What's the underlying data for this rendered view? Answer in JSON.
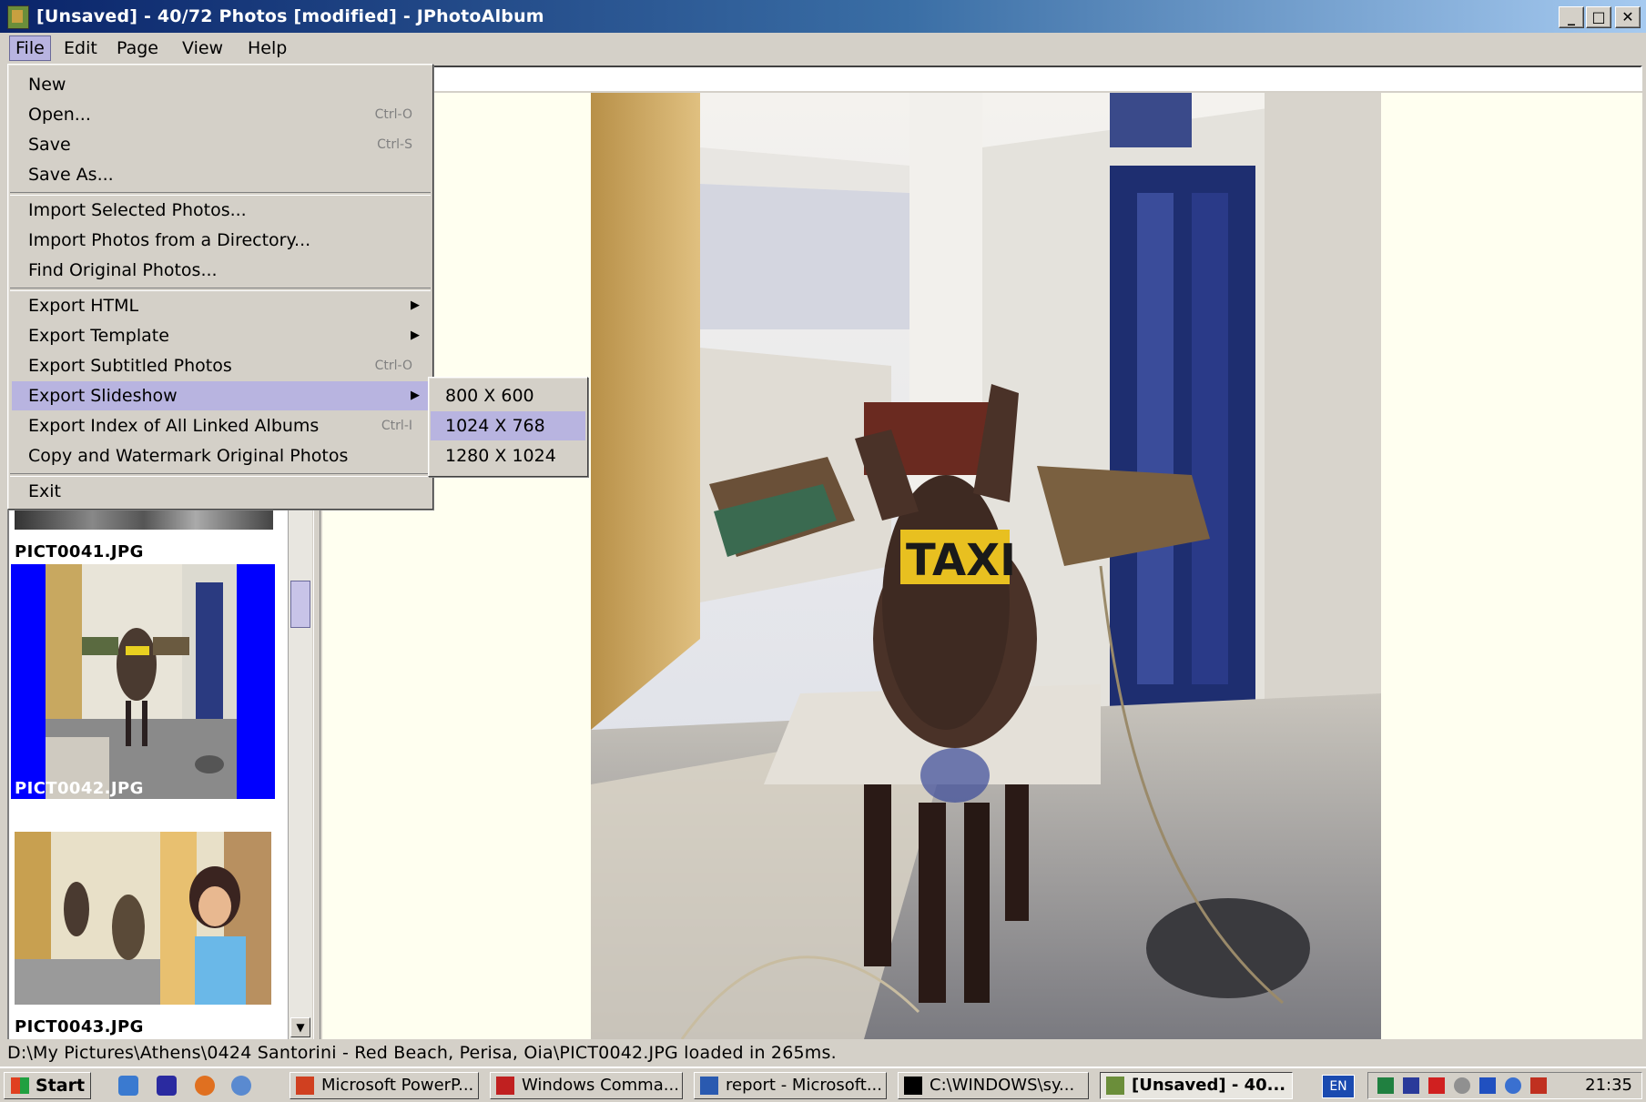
{
  "window": {
    "title": "[Unsaved] - 40/72 Photos  [modified] - JPhotoAlbum",
    "minimize": "_",
    "maximize": "□",
    "close": "✕"
  },
  "menubar": {
    "items": [
      {
        "label": "File"
      },
      {
        "label": "Edit"
      },
      {
        "label": "Page"
      },
      {
        "label": "View"
      },
      {
        "label": "Help"
      }
    ]
  },
  "file_menu": {
    "new": "New",
    "open": "Open...",
    "open_sc": "Ctrl-O",
    "save": "Save",
    "save_sc": "Ctrl-S",
    "save_as": "Save As...",
    "import_selected": "Import Selected Photos...",
    "import_dir": "Import Photos from a Directory...",
    "find_original": "Find Original Photos...",
    "export_html": "Export HTML",
    "export_template": "Export Template",
    "export_subtitled": "Export Subtitled Photos",
    "export_subtitled_sc": "Ctrl-O",
    "export_slideshow": "Export Slideshow",
    "export_index": "Export Index of All Linked Albums",
    "export_index_sc": "Ctrl-I",
    "copy_watermark": "Copy and Watermark Original Photos",
    "exit": "Exit"
  },
  "slideshow_submenu": {
    "opt1": "800 X 600",
    "opt2": "1024 X 768",
    "opt3": "1280 X 1024"
  },
  "thumbnails": [
    {
      "label": "PICT0041.JPG"
    },
    {
      "label": "PICT0042.JPG"
    },
    {
      "label": "PICT0043.JPG"
    }
  ],
  "status": "D:\\My Pictures\\Athens\\0424 Santorini - Red Beach, Perisa, Oia\\PICT0042.JPG loaded in 265ms.",
  "taskbar": {
    "start": "Start",
    "tasks": [
      {
        "label": "Microsoft PowerP..."
      },
      {
        "label": "Windows Comma..."
      },
      {
        "label": "report - Microsoft..."
      },
      {
        "label": "C:\\WINDOWS\\sy..."
      },
      {
        "label": "[Unsaved] - 40..."
      }
    ],
    "lang": "EN",
    "clock": "21:35"
  },
  "colors": {
    "selection_bg": "#0000ff",
    "menu_highlight": "#b8b4e0",
    "viewer_bg": "#fffff0"
  }
}
